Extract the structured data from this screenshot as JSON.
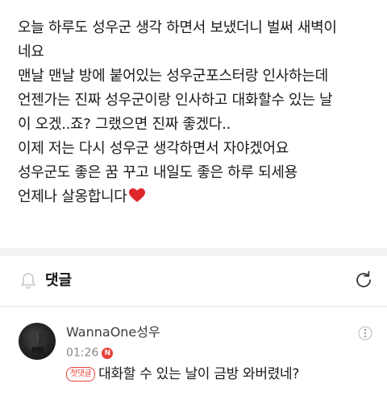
{
  "post": {
    "lines": [
      "오늘 하루도 성우군 생각 하면서 보냈더니 벌써 새벽이",
      "네요",
      "맨날 맨날 방에 붙어있는 성우군포스터랑 인사하는데",
      "언젠가는 진짜 성우군이랑 인사하고 대화할수 있는 날",
      "이 오겠..죠? 그랬으면 진짜 좋겠다..",
      "이제 저는 다시 성우군 생각하면서 자야겠어요",
      "성우군도 좋은 꿈 꾸고 내일도 좋은 하루 되세용",
      "언제나 살옹합니다"
    ],
    "end_icon": "red-heart-emoji"
  },
  "comments_section": {
    "title": "댓글",
    "bell_icon": "bell-icon",
    "refresh_icon": "refresh-icon"
  },
  "comment": {
    "author": "WannaOne성우",
    "time": "01:26",
    "new_badge": "N",
    "first_comment_badge": "첫댓글",
    "text": "대화할 수 있는 날이 금방 와버렸네?",
    "more_icon": "more-options-icon"
  },
  "colors": {
    "accent_red": "#e8403a",
    "heart_red": "#e0262b",
    "divider": "#f2f2f2"
  }
}
